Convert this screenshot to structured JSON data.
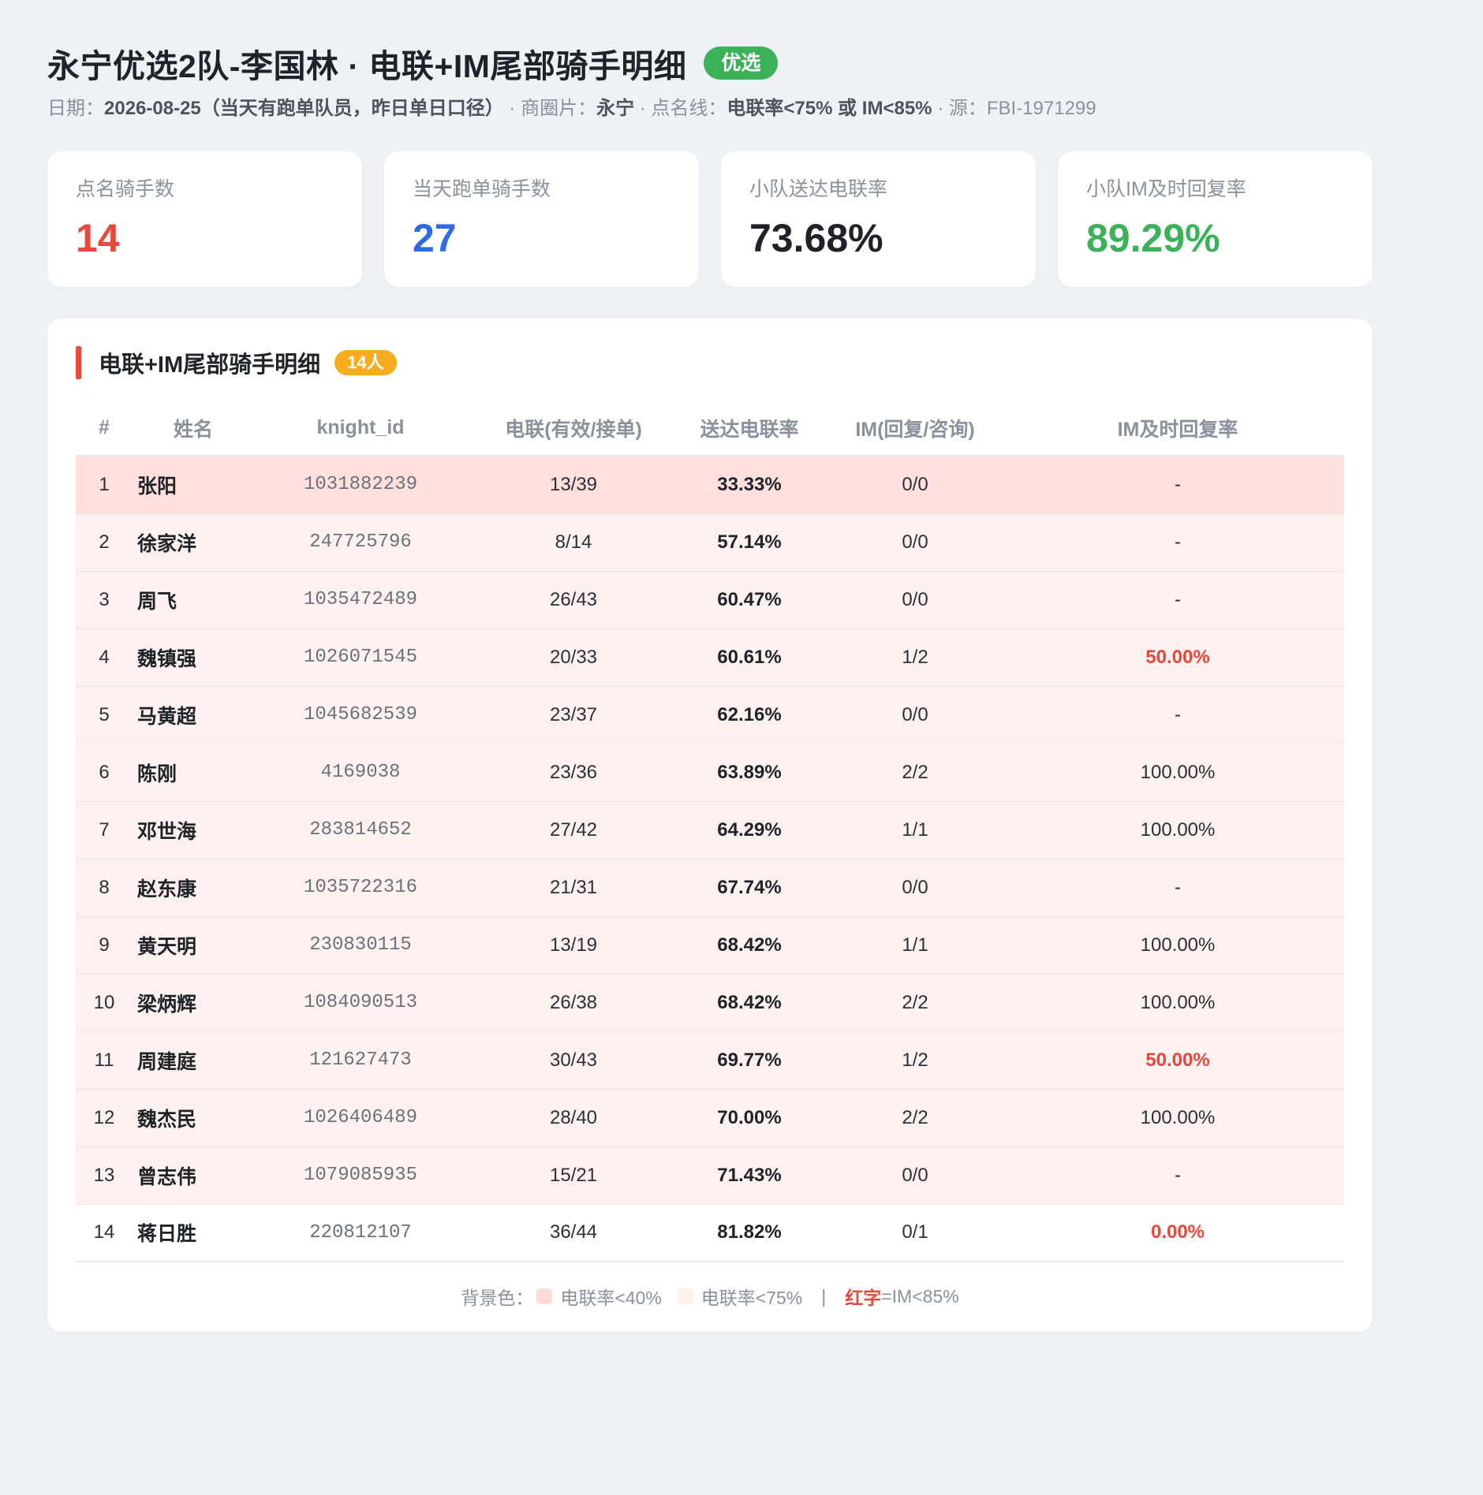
{
  "header": {
    "title": "永宁优选2队-李国林 · 电联+IM尾部骑手明细",
    "badge": "优选",
    "date_label": "日期：",
    "date_value": "2026-08-25（当天有跑单队员，昨日单日口径）",
    "sep1": " · 商圈片：",
    "area_value": "永宁",
    "sep2": " · 点名线：",
    "threshold_value": "电联率<75% 或 IM<85%",
    "sep3": " · 源：FBI-1971299"
  },
  "stats": [
    {
      "label": "点名骑手数",
      "value": "14",
      "color": "#e8473b"
    },
    {
      "label": "当天跑单骑手数",
      "value": "27",
      "color": "#2e6be6"
    },
    {
      "label": "小队送达电联率",
      "value": "73.68%",
      "color": "#1f2329"
    },
    {
      "label": "小队IM及时回复率",
      "value": "89.29%",
      "color": "#3bb15a"
    }
  ],
  "table": {
    "title": "电联+IM尾部骑手明细",
    "count_badge": "14人",
    "columns": [
      "#",
      "姓名",
      "knight_id",
      "电联(有效/接单)",
      "送达电联率",
      "IM(回复/咨询)",
      "IM及时回复率"
    ],
    "rows": [
      {
        "no": "1",
        "name": "张阳",
        "knight_id": "1031882239",
        "call": "13/39",
        "call_rate": "33.33%",
        "im": "0/0",
        "im_rate": "-",
        "bg": "deep",
        "im_red": false
      },
      {
        "no": "2",
        "name": "徐家洋",
        "knight_id": "247725796",
        "call": "8/14",
        "call_rate": "57.14%",
        "im": "0/0",
        "im_rate": "-",
        "bg": "light",
        "im_red": false
      },
      {
        "no": "3",
        "name": "周飞",
        "knight_id": "1035472489",
        "call": "26/43",
        "call_rate": "60.47%",
        "im": "0/0",
        "im_rate": "-",
        "bg": "light",
        "im_red": false
      },
      {
        "no": "4",
        "name": "魏镇强",
        "knight_id": "1026071545",
        "call": "20/33",
        "call_rate": "60.61%",
        "im": "1/2",
        "im_rate": "50.00%",
        "bg": "light",
        "im_red": true
      },
      {
        "no": "5",
        "name": "马黄超",
        "knight_id": "1045682539",
        "call": "23/37",
        "call_rate": "62.16%",
        "im": "0/0",
        "im_rate": "-",
        "bg": "light",
        "im_red": false
      },
      {
        "no": "6",
        "name": "陈刚",
        "knight_id": "4169038",
        "call": "23/36",
        "call_rate": "63.89%",
        "im": "2/2",
        "im_rate": "100.00%",
        "bg": "light",
        "im_red": false
      },
      {
        "no": "7",
        "name": "邓世海",
        "knight_id": "283814652",
        "call": "27/42",
        "call_rate": "64.29%",
        "im": "1/1",
        "im_rate": "100.00%",
        "bg": "light",
        "im_red": false
      },
      {
        "no": "8",
        "name": "赵东康",
        "knight_id": "1035722316",
        "call": "21/31",
        "call_rate": "67.74%",
        "im": "0/0",
        "im_rate": "-",
        "bg": "light",
        "im_red": false
      },
      {
        "no": "9",
        "name": "黄天明",
        "knight_id": "230830115",
        "call": "13/19",
        "call_rate": "68.42%",
        "im": "1/1",
        "im_rate": "100.00%",
        "bg": "light",
        "im_red": false
      },
      {
        "no": "10",
        "name": "梁炳辉",
        "knight_id": "1084090513",
        "call": "26/38",
        "call_rate": "68.42%",
        "im": "2/2",
        "im_rate": "100.00%",
        "bg": "light",
        "im_red": false
      },
      {
        "no": "11",
        "name": "周建庭",
        "knight_id": "121627473",
        "call": "30/43",
        "call_rate": "69.77%",
        "im": "1/2",
        "im_rate": "50.00%",
        "bg": "light",
        "im_red": true
      },
      {
        "no": "12",
        "name": "魏杰民",
        "knight_id": "1026406489",
        "call": "28/40",
        "call_rate": "70.00%",
        "im": "2/2",
        "im_rate": "100.00%",
        "bg": "light",
        "im_red": false
      },
      {
        "no": "13",
        "name": "曾志伟",
        "knight_id": "1079085935",
        "call": "15/21",
        "call_rate": "71.43%",
        "im": "0/0",
        "im_rate": "-",
        "bg": "light",
        "im_red": false
      },
      {
        "no": "14",
        "name": "蒋日胜",
        "knight_id": "220812107",
        "call": "36/44",
        "call_rate": "81.82%",
        "im": "0/1",
        "im_rate": "0.00%",
        "bg": "none",
        "im_red": true
      }
    ]
  },
  "legend": {
    "prefix": "背景色：",
    "deep_label": "电联率<40%",
    "deep_color": "#ffdcd6",
    "light_label": "电联率<75%",
    "light_color": "#fff0ee",
    "separator": "|",
    "red_word": "红字",
    "red_rest": "=IM<85%"
  }
}
